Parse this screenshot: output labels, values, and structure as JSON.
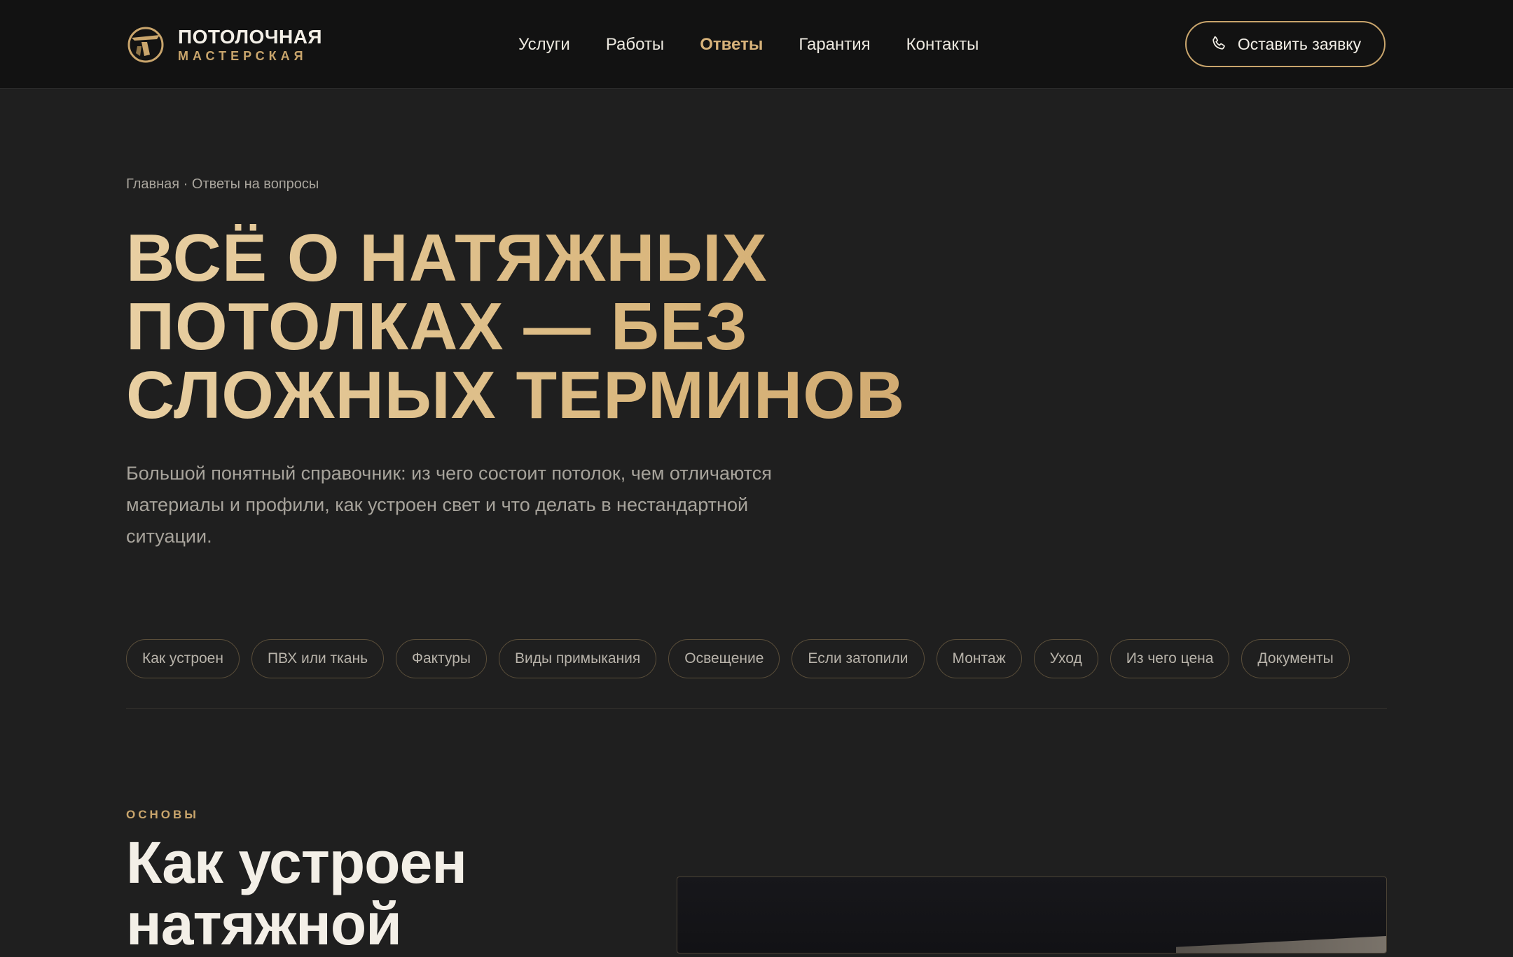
{
  "brand": {
    "line1": "ПОТОЛОЧНАЯ",
    "line2": "МАСТЕРСКАЯ",
    "icon": "ceiling-logo-icon",
    "accent": "#c9a56c"
  },
  "nav": {
    "items": [
      {
        "label": "Услуги",
        "active": false
      },
      {
        "label": "Работы",
        "active": false
      },
      {
        "label": "Ответы",
        "active": true
      },
      {
        "label": "Гарантия",
        "active": false
      },
      {
        "label": "Контакты",
        "active": false
      }
    ],
    "cta_label": "Оставить заявку",
    "cta_icon": "phone-icon"
  },
  "breadcrumb": {
    "home": "Главная",
    "separator": " · ",
    "current": "Ответы на вопросы"
  },
  "hero": {
    "title_lines": [
      "ВСЁ О НАТЯЖНЫХ",
      "ПОТОЛКАХ — БЕЗ",
      "СЛОЖНЫХ ТЕРМИНОВ"
    ],
    "lead": "Большой понятный справочник: из чего состоит потолок, чем отличаются материалы и профили, как устроен свет и что делать в нестандартной ситуации."
  },
  "topics": [
    "Как устроен",
    "ПВХ или ткань",
    "Фактуры",
    "Виды примыкания",
    "Освещение",
    "Если затопили",
    "Монтаж",
    "Уход",
    "Из чего цена",
    "Документы"
  ],
  "section": {
    "eyebrow": "ОСНОВЫ",
    "title_lines": [
      "Как устроен",
      "натяжной"
    ]
  },
  "colors": {
    "background": "#1f1f1f",
    "header": "#121212",
    "title_gold": "#dcba84",
    "text_muted": "#a7a39b"
  }
}
